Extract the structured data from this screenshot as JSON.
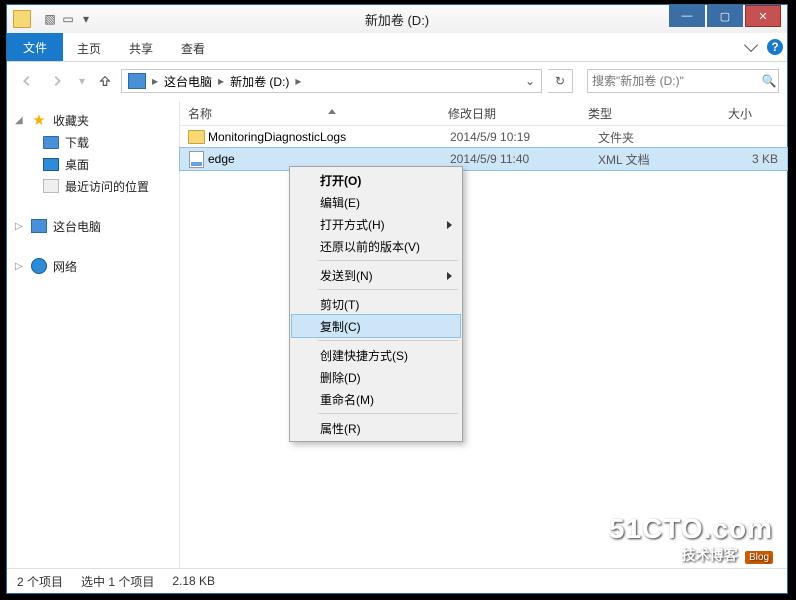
{
  "window": {
    "title": "新加卷 (D:)"
  },
  "ribbon": {
    "file": "文件",
    "tabs": [
      "主页",
      "共享",
      "查看"
    ]
  },
  "breadcrumb": {
    "root": "这台电脑",
    "path": "新加卷 (D:)"
  },
  "search": {
    "placeholder": "搜索\"新加卷 (D:)\""
  },
  "columns": {
    "name": "名称",
    "date": "修改日期",
    "type": "类型",
    "size": "大小"
  },
  "sidebar": {
    "favorites": "收藏夹",
    "downloads": "下载",
    "desktop": "桌面",
    "recent": "最近访问的位置",
    "this_pc": "这台电脑",
    "network": "网络"
  },
  "files": [
    {
      "name": "MonitoringDiagnosticLogs",
      "date": "2014/5/9 10:19",
      "type": "文件夹",
      "size": ""
    },
    {
      "name": "edge",
      "date": "2014/5/9 11:40",
      "type": "XML 文档",
      "size": "3 KB"
    }
  ],
  "context_menu": {
    "open": "打开(O)",
    "edit": "编辑(E)",
    "open_with": "打开方式(H)",
    "restore": "还原以前的版本(V)",
    "send_to": "发送到(N)",
    "cut": "剪切(T)",
    "copy": "复制(C)",
    "shortcut": "创建快捷方式(S)",
    "delete": "删除(D)",
    "rename": "重命名(M)",
    "properties": "属性(R)"
  },
  "status": {
    "count": "2 个项目",
    "selection": "选中 1 个项目",
    "size": "2.18 KB"
  },
  "watermark": {
    "big": "51CTO.com",
    "sm": "技术博客",
    "blog": "Blog"
  }
}
